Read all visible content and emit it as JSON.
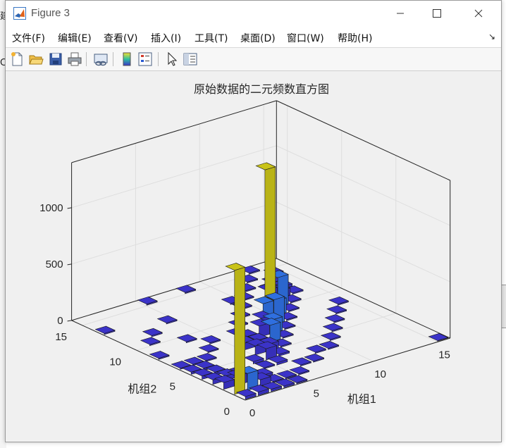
{
  "window": {
    "title": "Figure 3"
  },
  "menu": [
    "文件(F)",
    "编辑(E)",
    "查看(V)",
    "插入(I)",
    "工具(T)",
    "桌面(D)",
    "窗口(W)",
    "帮助(H)"
  ],
  "toolbar": [
    "new-figure",
    "open-file",
    "save",
    "print",
    "link-plot",
    "insert-colorbar",
    "insert-legend",
    "select-pointer",
    "property-editor"
  ],
  "background_fragments": [
    "建",
    "C"
  ],
  "colors": {
    "bar_face_low": "#3b33c8",
    "bar_face_mid": "#2f6fe0",
    "bar_face_high": "#c9c318",
    "grid": "#dedede"
  },
  "chart_data": {
    "type": "bar3",
    "title": "原始数据的二元频数直方图",
    "xlabel": "机组1",
    "ylabel": "机组2",
    "xticks": [
      0,
      5,
      10,
      15
    ],
    "yticks": [
      0,
      5,
      10,
      15
    ],
    "zticks": [
      0,
      500,
      1000
    ],
    "xlim": [
      0,
      16
    ],
    "ylim": [
      0,
      16
    ],
    "zlim": [
      0,
      1400
    ],
    "grid": true,
    "bins": [
      [
        0,
        0,
        25
      ],
      [
        1,
        0,
        30
      ],
      [
        2,
        0,
        20
      ],
      [
        3,
        0,
        15
      ],
      [
        4,
        0,
        10
      ],
      [
        15,
        0,
        5
      ],
      [
        0,
        1,
        1100
      ],
      [
        0,
        2,
        60
      ],
      [
        0,
        3,
        40
      ],
      [
        0,
        4,
        30
      ],
      [
        0,
        5,
        20
      ],
      [
        0,
        6,
        10
      ],
      [
        1,
        1,
        150
      ],
      [
        1,
        2,
        80
      ],
      [
        1,
        3,
        40
      ],
      [
        1,
        4,
        30
      ],
      [
        1,
        5,
        20
      ],
      [
        1,
        6,
        10
      ],
      [
        2,
        1,
        60
      ],
      [
        2,
        2,
        40
      ],
      [
        2,
        3,
        30
      ],
      [
        3,
        2,
        20
      ],
      [
        4,
        3,
        10
      ],
      [
        5,
        4,
        100
      ],
      [
        5,
        5,
        80
      ],
      [
        5,
        6,
        60
      ],
      [
        6,
        5,
        60
      ],
      [
        6,
        6,
        50
      ],
      [
        6,
        7,
        40
      ],
      [
        7,
        6,
        150
      ],
      [
        7,
        7,
        100
      ],
      [
        8,
        7,
        120
      ],
      [
        8,
        8,
        90
      ],
      [
        9,
        8,
        220
      ],
      [
        9,
        9,
        140
      ],
      [
        10,
        9,
        130
      ],
      [
        10,
        10,
        1250
      ],
      [
        11,
        10,
        260
      ],
      [
        11,
        11,
        100
      ],
      [
        12,
        11,
        60
      ],
      [
        12,
        12,
        30
      ],
      [
        13,
        12,
        20
      ],
      [
        13,
        13,
        10
      ],
      [
        4,
        4,
        20
      ],
      [
        5,
        3,
        20
      ],
      [
        6,
        4,
        15
      ],
      [
        7,
        5,
        10
      ],
      [
        8,
        6,
        10
      ],
      [
        9,
        7,
        10
      ],
      [
        10,
        8,
        10
      ],
      [
        11,
        9,
        10
      ],
      [
        12,
        10,
        10
      ],
      [
        13,
        11,
        10
      ],
      [
        2,
        6,
        10
      ],
      [
        3,
        7,
        10
      ],
      [
        4,
        8,
        10
      ],
      [
        3,
        9,
        10
      ],
      [
        2,
        11,
        10
      ],
      [
        4,
        12,
        10
      ],
      [
        5,
        15,
        10
      ],
      [
        6,
        8,
        10
      ],
      [
        7,
        9,
        10
      ],
      [
        8,
        10,
        10
      ],
      [
        9,
        11,
        10
      ],
      [
        9,
        12,
        10
      ],
      [
        10,
        12,
        10
      ],
      [
        11,
        13,
        10
      ],
      [
        12,
        14,
        10
      ],
      [
        13,
        15,
        10
      ],
      [
        14,
        14,
        10
      ],
      [
        3,
        1,
        10
      ],
      [
        4,
        1,
        10
      ],
      [
        5,
        1,
        10
      ],
      [
        6,
        2,
        10
      ],
      [
        7,
        2,
        10
      ],
      [
        8,
        3,
        10
      ],
      [
        9,
        3,
        10
      ],
      [
        10,
        4,
        10
      ],
      [
        11,
        5,
        10
      ],
      [
        12,
        6,
        10
      ],
      [
        13,
        7,
        10
      ],
      [
        14,
        8,
        10
      ],
      [
        0,
        8,
        10
      ],
      [
        0,
        13,
        10
      ],
      [
        1,
        10,
        10
      ],
      [
        8,
        15,
        10
      ]
    ]
  }
}
